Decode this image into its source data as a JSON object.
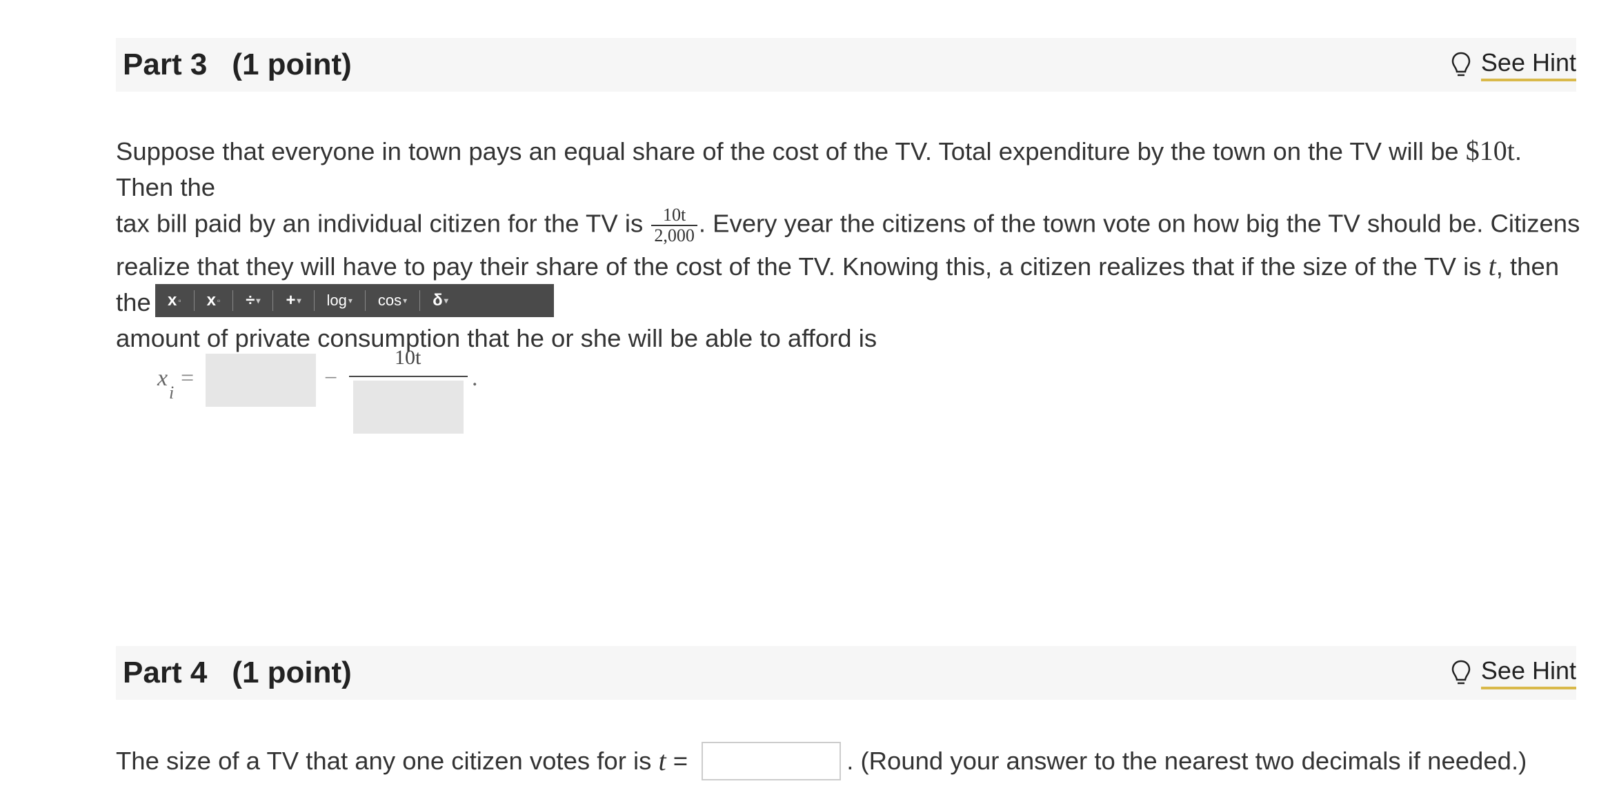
{
  "part3": {
    "title": "Part 3",
    "points": "(1 point)",
    "hint_label": "See Hint",
    "text_line1_a": "Suppose that everyone in town pays an equal share of the cost of the TV. Total expenditure by the town on the TV will be ",
    "text_line1_math": "$10t",
    "text_line1_b": ". Then the",
    "text_line2_a": "tax bill paid by an individual citizen for the TV is ",
    "frac_num": "10t",
    "frac_den": "2,000",
    "text_line2_b": ". Every year the citizens of the town vote on how big the TV should be. Citizens",
    "text_line3_a": "realize that they will have to pay their share of the cost of the TV. Knowing this, a citizen realizes that if the size of the TV is ",
    "text_line3_math": "t",
    "text_line3_b": ", then the",
    "text_line4": "amount of private consumption that he or she will be able to afford is"
  },
  "toolbar": {
    "btn1": "x",
    "btn1_sub": "▫",
    "btn2": "x",
    "btn2_sub": "▫",
    "btn3": "÷",
    "btn4": "+",
    "btn5": "log",
    "btn6": "cos",
    "btn7": "δ"
  },
  "equation": {
    "lhs": "x",
    "lhs_sub": "i",
    "equals": "=",
    "minus": "−",
    "numerator": "10t",
    "period": "."
  },
  "part4": {
    "title": "Part 4",
    "points": "(1 point)",
    "hint_label": "See Hint",
    "question_a": "The size of a TV that any one citizen votes for is ",
    "question_math": "t",
    "question_eq": " = ",
    "question_b": ". (Round your answer to the nearest two decimals if needed.)"
  }
}
